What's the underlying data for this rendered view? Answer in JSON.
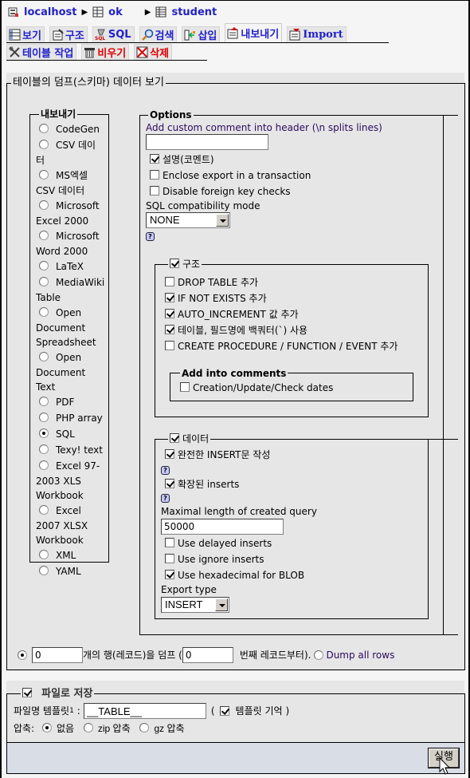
{
  "breadcrumb": {
    "server": "localhost",
    "database": "ok",
    "table": "student"
  },
  "tabs_row1": [
    {
      "label": "보기",
      "icon": "browse-icon",
      "active": false
    },
    {
      "label": "구조",
      "icon": "structure-icon",
      "active": false
    },
    {
      "label": "SQL",
      "icon": "sql-icon",
      "active": false
    },
    {
      "label": "검색",
      "icon": "search-icon",
      "active": false
    },
    {
      "label": "삽입",
      "icon": "insert-icon",
      "active": false
    },
    {
      "label": "내보내기",
      "icon": "export-icon",
      "active": true
    },
    {
      "label": "Import",
      "icon": "import-icon",
      "active": false
    }
  ],
  "tabs_row2": [
    {
      "label": "테이블 작업",
      "icon": "operations-icon",
      "danger": false
    },
    {
      "label": "비우기",
      "icon": "empty-trash-icon",
      "danger": true
    },
    {
      "label": "삭제",
      "icon": "drop-icon",
      "danger": true
    }
  ],
  "dump_section": {
    "legend": "테이블의 덤프(스키마) 데이터 보기",
    "export_legend": "내보내기",
    "formats": [
      {
        "label": "CodeGen",
        "lines": [
          "CodeGen"
        ],
        "selected": false
      },
      {
        "label": "CSV 데이터",
        "lines": [
          "CSV 데이",
          "터"
        ],
        "selected": false
      },
      {
        "label": "MS엑셀 CSV 데이터",
        "lines": [
          "MS엑셀",
          "CSV 데이터"
        ],
        "selected": false
      },
      {
        "label": "Microsoft Excel 2000",
        "lines": [
          "Microsoft",
          "Excel 2000"
        ],
        "selected": false
      },
      {
        "label": "Microsoft Word 2000",
        "lines": [
          "Microsoft",
          "Word 2000"
        ],
        "selected": false
      },
      {
        "label": "LaTeX",
        "lines": [
          "LaTeX"
        ],
        "selected": false
      },
      {
        "label": "MediaWiki Table",
        "lines": [
          "MediaWiki",
          "Table"
        ],
        "selected": false
      },
      {
        "label": "Open Document Spreadsheet",
        "lines": [
          "Open",
          "Document",
          "Spreadsheet"
        ],
        "selected": false
      },
      {
        "label": "Open Document Text",
        "lines": [
          "Open",
          "Document",
          "Text"
        ],
        "selected": false
      },
      {
        "label": "PDF",
        "lines": [
          "PDF"
        ],
        "selected": false
      },
      {
        "label": "PHP array",
        "lines": [
          "PHP array"
        ],
        "selected": false
      },
      {
        "label": "SQL",
        "lines": [
          "SQL"
        ],
        "selected": true
      },
      {
        "label": "Texy! text",
        "lines": [
          "Texy! text"
        ],
        "selected": false
      },
      {
        "label": "Excel 97-2003 XLS Workbook",
        "lines": [
          "Excel 97-",
          "2003 XLS",
          "Workbook"
        ],
        "selected": false
      },
      {
        "label": "Excel 2007 XLSX Workbook",
        "lines": [
          "Excel",
          "2007 XLSX",
          "Workbook"
        ],
        "selected": false
      },
      {
        "label": "XML",
        "lines": [
          "XML"
        ],
        "selected": false
      },
      {
        "label": "YAML",
        "lines": [
          "YAML"
        ],
        "selected": false
      }
    ]
  },
  "options": {
    "legend": "Options",
    "comment_label": "Add custom comment into header (\\n splits lines)",
    "comment_value": "",
    "comments_checkbox": {
      "label": "설명(코멘트)",
      "checked": true
    },
    "transaction_checkbox": {
      "label": "Enclose export in a transaction",
      "checked": false
    },
    "fk_checkbox": {
      "label": "Disable foreign key checks",
      "checked": false
    },
    "compat_label": "SQL compatibility mode",
    "compat_value": "NONE",
    "help": "?"
  },
  "structure": {
    "legend": "구조",
    "checked": true,
    "items": [
      {
        "label": "DROP TABLE 추가",
        "checked": false
      },
      {
        "label": "IF NOT EXISTS 추가",
        "checked": true
      },
      {
        "label": "AUTO_INCREMENT 값 추가",
        "checked": true
      },
      {
        "label": "테이블, 필드명에 백쿼터(`) 사용",
        "checked": true
      },
      {
        "label": "CREATE PROCEDURE / FUNCTION / EVENT 추가",
        "checked": false
      }
    ],
    "comments_legend": "Add into comments",
    "dates": {
      "label": "Creation/Update/Check dates",
      "checked": false
    }
  },
  "data": {
    "legend": "데이터",
    "checked": true,
    "complete_inserts": {
      "label": "완전한 INSERT문 작성",
      "checked": true
    },
    "extended_inserts": {
      "label": "확장된 inserts",
      "checked": true
    },
    "max_query_label": "Maximal length of created query",
    "max_query_value": "50000",
    "delayed": {
      "label": "Use delayed inserts",
      "checked": false
    },
    "ignore": {
      "label": "Use ignore inserts",
      "checked": false
    },
    "hex_blob": {
      "label": "Use hexadecimal for BLOB",
      "checked": true
    },
    "export_type_label": "Export type",
    "export_type_value": "INSERT"
  },
  "rows": {
    "count_value": "0",
    "text1": "개의 행(레코드)을 덤프 (",
    "start_value": "0",
    "text2": "번째 레코드부터).",
    "dump_all": "Dump all rows",
    "selected": "rows"
  },
  "save_file": {
    "legend": "파일로 저장",
    "checked": true,
    "template_label": "파일명 템플릿",
    "template_sup": "1",
    "template_colon": ":",
    "template_value": "__TABLE__",
    "remember_open": "(",
    "remember_label": "템플릿 기억",
    "remember_close": ")",
    "remember_checked": true,
    "compression_label": "압축:",
    "compression": [
      {
        "label": "없음",
        "selected": true
      },
      {
        "label": "zip 압축",
        "selected": false
      },
      {
        "label": "gz 압축",
        "selected": false
      }
    ]
  },
  "go_button": "실행"
}
